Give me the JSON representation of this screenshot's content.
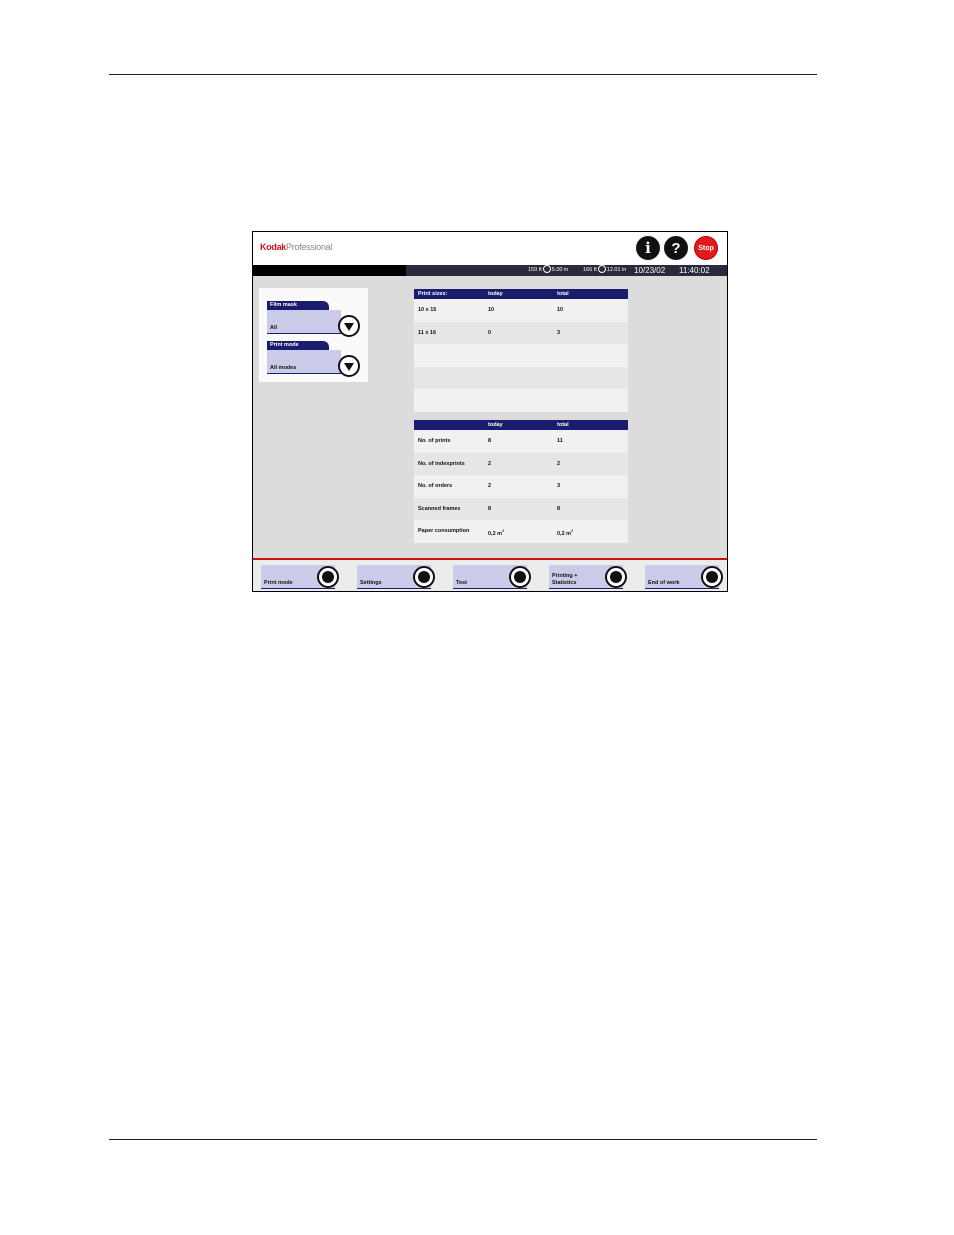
{
  "header": {
    "brand_primary": "Kodak",
    "brand_secondary": "Professional",
    "info_label": "i",
    "help_label": "?",
    "stop_label": "Stop",
    "accent_color": "#d4141c"
  },
  "status": {
    "roll1_length": "159 ft",
    "roll1_width": "5.00 in",
    "roll2_length": "166 ft",
    "roll2_width": "12.01 in",
    "date": "10/23/02",
    "time": "11:40:02"
  },
  "selectors": [
    {
      "label": "Film mask",
      "value": "All"
    },
    {
      "label": "Print mode",
      "value": "All modes"
    }
  ],
  "print_sizes_table": {
    "headers": [
      "Print sizes:",
      "today",
      "total"
    ],
    "rows": [
      [
        "10 x 15",
        "10",
        "10"
      ],
      [
        "11 x 16",
        "0",
        "3"
      ],
      [
        "",
        "",
        ""
      ],
      [
        "",
        "",
        ""
      ],
      [
        "",
        "",
        ""
      ]
    ]
  },
  "stats_table": {
    "headers": [
      "",
      "today",
      "total"
    ],
    "rows": [
      [
        "No. of prints",
        "8",
        "11"
      ],
      [
        "No. of indexprints",
        "2",
        "2"
      ],
      [
        "No. of orders",
        "2",
        "3"
      ],
      [
        "Scanned frames",
        "8",
        "8"
      ],
      [
        "Paper consumption",
        "0,2 m",
        "0,2 m"
      ]
    ],
    "unit_superscript": "2"
  },
  "footer_buttons": [
    {
      "line1": "",
      "line2": "Print mode"
    },
    {
      "line1": "",
      "line2": "Settings"
    },
    {
      "line1": "",
      "line2": "Test"
    },
    {
      "line1": "Printing +",
      "line2": "Statistics"
    },
    {
      "line1": "",
      "line2": "End of work"
    }
  ]
}
